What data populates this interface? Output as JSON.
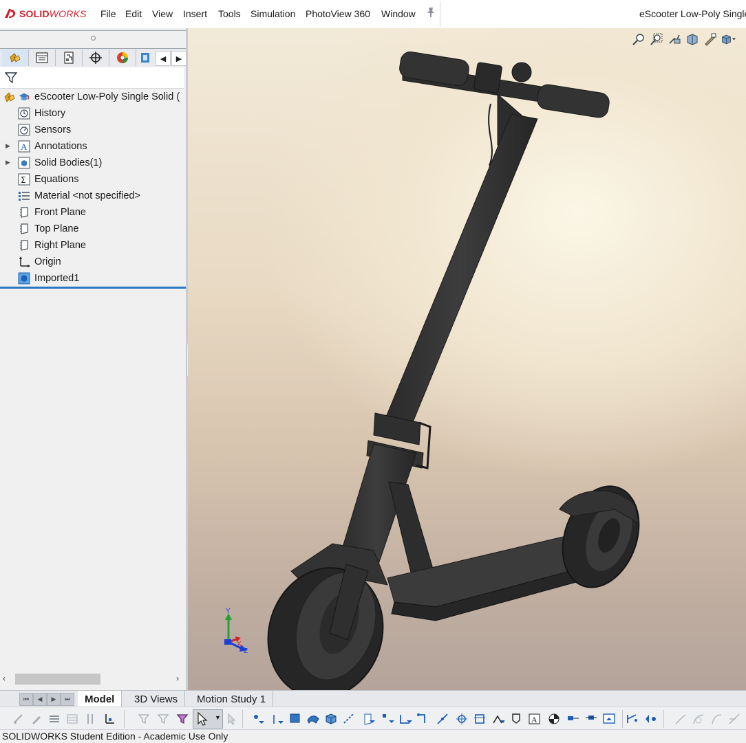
{
  "app": {
    "logo_text_bold": "SOLID",
    "logo_text_italic": "WORKS",
    "brand_color": "#d0222c",
    "document_title": "eScooter Low-Poly Single"
  },
  "menu": [
    {
      "label": "File"
    },
    {
      "label": "Edit"
    },
    {
      "label": "View"
    },
    {
      "label": "Insert"
    },
    {
      "label": "Tools"
    },
    {
      "label": "Simulation"
    },
    {
      "label": "PhotoView 360"
    },
    {
      "label": "Window"
    }
  ],
  "manager_tabs": [
    {
      "icon": "featuremanager-icon"
    },
    {
      "icon": "propertymanager-icon"
    },
    {
      "icon": "configurationmanager-icon"
    },
    {
      "icon": "dimxpertmanager-icon"
    },
    {
      "icon": "displaymanager-icon"
    },
    {
      "icon": "cam-icon"
    }
  ],
  "tree": {
    "root": {
      "label": "eScooter Low-Poly Single Solid  (",
      "icon": "part-icon"
    },
    "items": [
      {
        "label": "History",
        "icon": "history-icon",
        "expandable": false
      },
      {
        "label": "Sensors",
        "icon": "sensors-icon",
        "expandable": false
      },
      {
        "label": "Annotations",
        "icon": "annotations-icon",
        "expandable": true
      },
      {
        "label": "Solid Bodies(1)",
        "icon": "solid-bodies-icon",
        "expandable": true
      },
      {
        "label": "Equations",
        "icon": "equations-icon",
        "expandable": false
      },
      {
        "label": "Material <not specified>",
        "icon": "material-icon",
        "expandable": false
      },
      {
        "label": "Front Plane",
        "icon": "plane-icon",
        "expandable": false
      },
      {
        "label": "Top Plane",
        "icon": "plane-icon",
        "expandable": false
      },
      {
        "label": "Right Plane",
        "icon": "plane-icon",
        "expandable": false
      },
      {
        "label": "Origin",
        "icon": "origin-icon",
        "expandable": false
      },
      {
        "label": "Imported1",
        "icon": "imported-body-icon",
        "expandable": false
      }
    ]
  },
  "triad": {
    "x": "X",
    "y": "Y",
    "z": "Z"
  },
  "bottom_tabs": [
    {
      "label": "Model",
      "active": true
    },
    {
      "label": "3D Views",
      "active": false
    },
    {
      "label": "Motion Study 1",
      "active": false
    }
  ],
  "status_bar": {
    "text": "SOLIDWORKS Student Edition - Academic Use Only"
  },
  "colors": {
    "selection_accent": "#2b78c2",
    "sketch_blue": "#1d5fb8"
  }
}
